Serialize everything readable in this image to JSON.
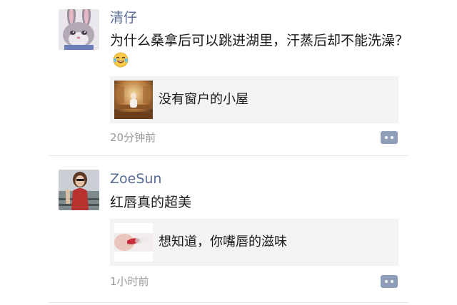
{
  "posts": [
    {
      "username": "清仔",
      "avatar_icon": "cartoon-bunny-avatar",
      "text": "为什么桑拿后可以跳进湖里，汗蒸后却不能洗澡？",
      "emoji": "tears-of-joy-emoji",
      "link": {
        "title": "没有窗户的小屋",
        "thumbnail": "sauna-room-thumbnail"
      },
      "time": "20分钟前",
      "comment_icon": "comment-icon"
    },
    {
      "username": "ZoeSun",
      "avatar_icon": "woman-portrait-avatar",
      "text": "红唇真的超美",
      "link": {
        "title": "想知道，你嘴唇的滋味",
        "thumbnail": "red-lips-thumbnail"
      },
      "time": "1小时前",
      "comment_icon": "comment-icon"
    }
  ],
  "colors": {
    "username": "#576b95",
    "card_bg": "#f3f3f5",
    "timestamp": "#9a9a9a",
    "comment_btn": "#8e9db8"
  }
}
